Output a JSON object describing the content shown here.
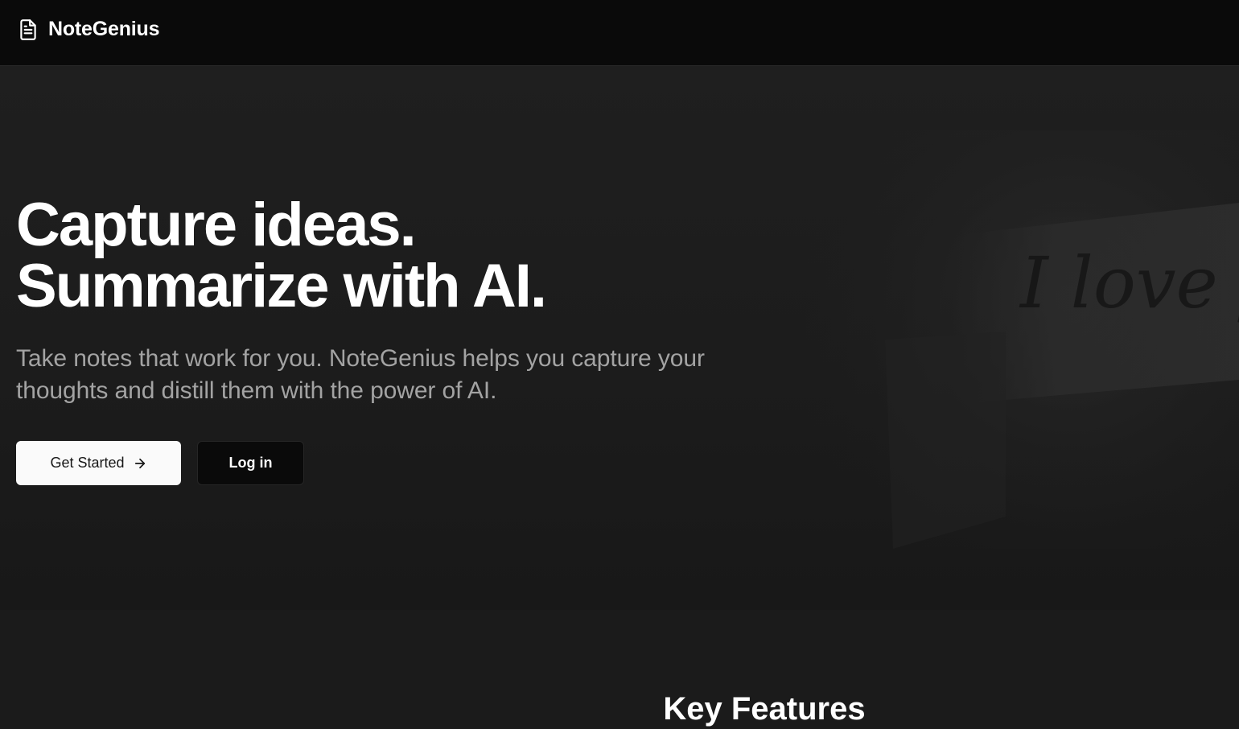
{
  "brand": {
    "name": "NoteGenius",
    "icon": "file-text-icon"
  },
  "hero": {
    "title_line1": "Capture ideas.",
    "title_line2": "Summarize with AI.",
    "subtitle": "Take notes that work for you. NoteGenius helps you capture your thoughts and distill them with the power of AI.",
    "primary_button": {
      "label": "Get Started",
      "icon": "arrow-right-icon"
    },
    "secondary_button": {
      "label": "Log in"
    },
    "background_art_text": "I love yo"
  },
  "features": {
    "title": "Key Features"
  },
  "colors": {
    "nav_background": "#0a0a0a",
    "page_background": "#1b1b1b",
    "primary_button_background": "#fafafa",
    "secondary_button_background": "#0a0a0a",
    "subtitle_text": "#a3a3a3"
  }
}
